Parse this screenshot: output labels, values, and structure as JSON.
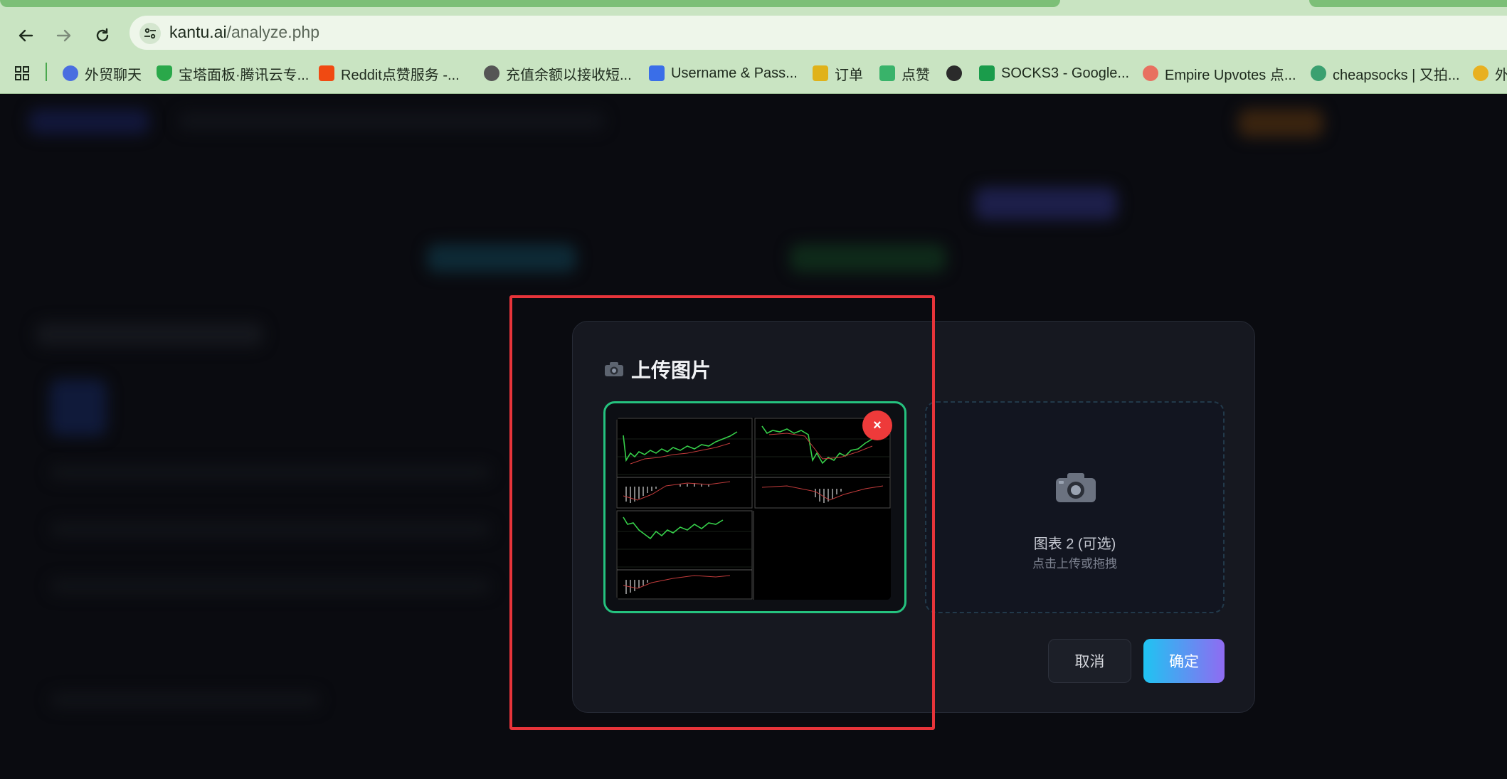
{
  "browser": {
    "url_domain": "kantu.ai",
    "url_path": "/analyze.php",
    "bookmarks": [
      {
        "label": "",
        "icon": "apps-grid-icon"
      },
      {
        "label": "外贸聊天",
        "icon": "chat-bot-icon",
        "color": "#4a6ee0"
      },
      {
        "label": "宝塔面板·腾讯云专...",
        "icon": "shield-icon",
        "color": "#2aa84a"
      },
      {
        "label": "Reddit点赞服务 -...",
        "icon": "reddit-upvote-icon",
        "color": "#f04a12"
      },
      {
        "label": "充值余额以接收短...",
        "icon": "moon-icon",
        "color": "#555555"
      },
      {
        "label": "Username & Pass...",
        "icon": "ip2-icon",
        "color": "#3a6ee8"
      },
      {
        "label": "订单",
        "icon": "order-table-icon",
        "color": "#e0b21a"
      },
      {
        "label": "点赞",
        "icon": "fen-icon",
        "color": "#39b36a"
      },
      {
        "label": "",
        "icon": "globe-icon",
        "color": "#2b2b2b"
      },
      {
        "label": "SOCKS3 - Google...",
        "icon": "google-sheets-icon",
        "color": "#1a9c4b"
      },
      {
        "label": "Empire Upvotes 点...",
        "icon": "empire-icon",
        "color": "#e87060"
      },
      {
        "label": "cheapsocks | 又拍...",
        "icon": "socks-icon",
        "color": "#3aa070"
      },
      {
        "label": "外",
        "icon": "coin-icon",
        "color": "#e8b020"
      }
    ]
  },
  "modal": {
    "title_icon": "camera-icon",
    "title": "上传图片",
    "slot1_remove": "×",
    "slot2_label": "图表 2 (可选)",
    "slot2_hint": "点击上传或拖拽",
    "cancel_label": "取消",
    "confirm_label": "确定"
  }
}
